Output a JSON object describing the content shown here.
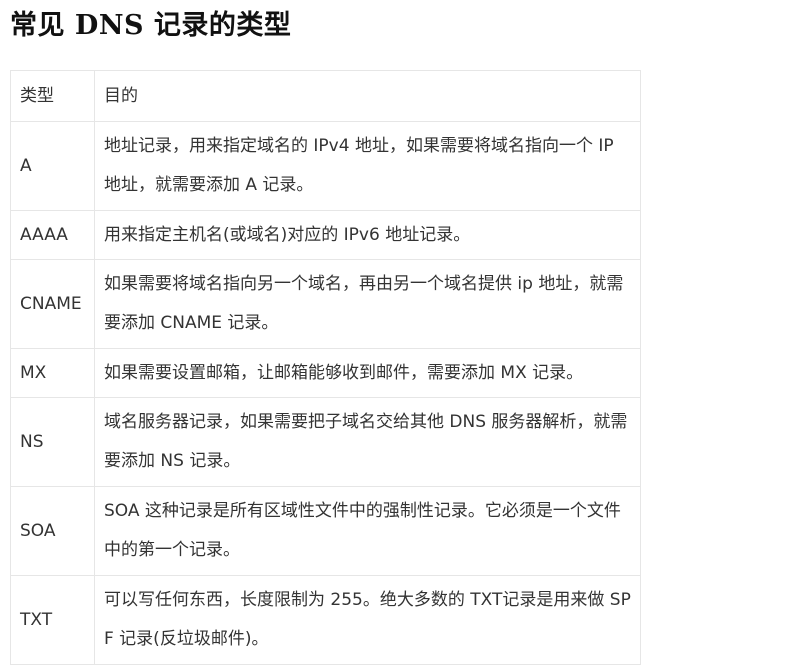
{
  "article": {
    "title": "常见 DNS 记录的类型"
  },
  "table": {
    "headers": {
      "type": "类型",
      "purpose": "目的"
    },
    "rows": [
      {
        "type": "A",
        "purpose": "地址记录，用来指定域名的 IPv4 地址，如果需要将域名指向一个 IP 地址，就需要添加 A 记录。"
      },
      {
        "type": "AAAA",
        "purpose": "用来指定主机名(或域名)对应的 IPv6 地址记录。"
      },
      {
        "type": "CNAME",
        "purpose": "如果需要将域名指向另一个域名，再由另一个域名提供 ip 地址，就需要添加 CNAME 记录。"
      },
      {
        "type": "MX",
        "purpose": "如果需要设置邮箱，让邮箱能够收到邮件，需要添加 MX 记录。"
      },
      {
        "type": "NS",
        "purpose": "域名服务器记录，如果需要把子域名交给其他 DNS 服务器解析，就需要添加 NS 记录。"
      },
      {
        "type": "SOA",
        "purpose": "SOA 这种记录是所有区域性文件中的强制性记录。它必须是一个文件中的第一个记录。"
      },
      {
        "type": "TXT",
        "purpose": "可以写任何东西，长度限制为 255。绝大多数的 TXT记录是用来做 SPF 记录(反垃圾邮件)。"
      }
    ]
  }
}
